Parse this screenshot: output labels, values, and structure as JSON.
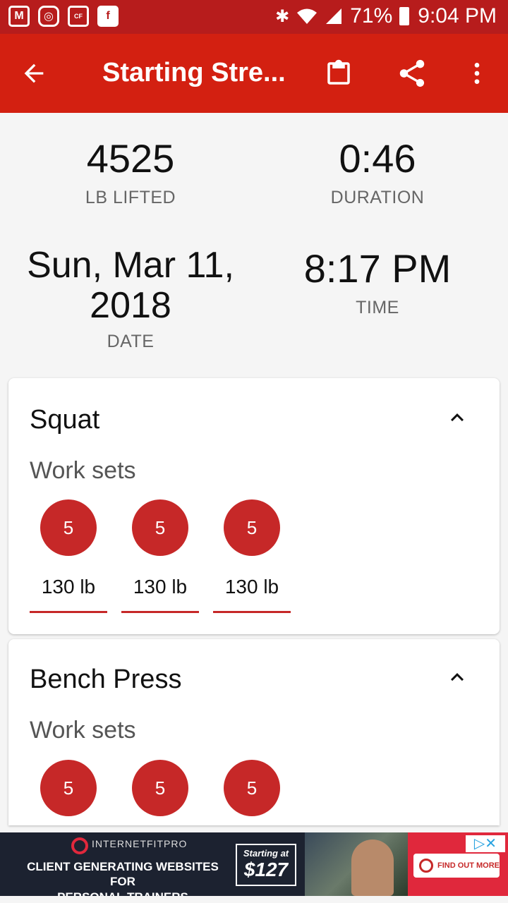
{
  "status_bar": {
    "battery": "71%",
    "time": "9:04 PM",
    "left_icons": [
      "gmail-icon",
      "instagram-icon",
      "crossfit-games-icon",
      "flipboard-icon"
    ],
    "right_icons": [
      "bluetooth-icon",
      "wifi-icon",
      "signal-icon",
      "battery-icon"
    ]
  },
  "app_bar": {
    "title": "Starting Stre...",
    "back_icon": "arrow-back-icon",
    "actions": [
      "clipboard-icon",
      "share-icon",
      "more-vert-icon"
    ]
  },
  "summary": {
    "lifted_value": "4525",
    "lifted_label": "LB LIFTED",
    "duration_value": "0:46",
    "duration_label": "DURATION",
    "date_line1": "Sun, Mar 11,",
    "date_line2": "2018",
    "date_label": "DATE",
    "time_value": "8:17 PM",
    "time_label": "TIME"
  },
  "exercises": [
    {
      "name": "Squat",
      "section": "Work sets",
      "sets": [
        {
          "reps": "5",
          "weight": "130 lb"
        },
        {
          "reps": "5",
          "weight": "130 lb"
        },
        {
          "reps": "5",
          "weight": "130 lb"
        }
      ]
    },
    {
      "name": "Bench Press",
      "section": "Work sets",
      "sets": [
        {
          "reps": "5"
        },
        {
          "reps": "5"
        },
        {
          "reps": "5"
        }
      ]
    }
  ],
  "ad": {
    "brand": "INTERNETFITPRO",
    "headline_line1": "CLIENT GENERATING WEBSITES FOR",
    "headline_line2": "PERSONAL TRAINERS",
    "price_top": "Starting at",
    "price": "$127",
    "cta": "FIND OUT MORE"
  },
  "colors": {
    "status_bar": "#b71c1c",
    "app_bar": "#d32011",
    "accent": "#c62828",
    "background": "#f5f5f5"
  }
}
